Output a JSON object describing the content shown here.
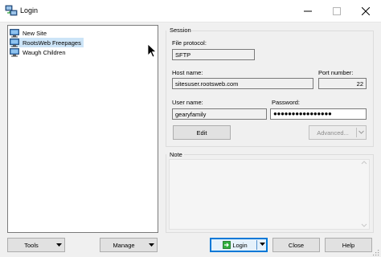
{
  "window": {
    "title": "Login",
    "controls": {
      "minimize": "minimize-icon",
      "maximize": "maximize-icon",
      "close": "close-icon"
    }
  },
  "sites": {
    "items": [
      {
        "label": "New Site",
        "icon": "computer-icon",
        "selected": false
      },
      {
        "label": "RootsWeb Freepages",
        "icon": "computer-icon",
        "selected": true
      },
      {
        "label": "Waugh Children",
        "icon": "computer-icon",
        "selected": false
      }
    ]
  },
  "session": {
    "group_label": "Session",
    "file_protocol": {
      "label": "File protocol:",
      "value": "SFTP"
    },
    "host_name": {
      "label": "Host name:",
      "value": "sitesuser.rootsweb.com"
    },
    "port_number": {
      "label": "Port number:",
      "value": "22"
    },
    "user_name": {
      "label": "User name:",
      "value": "gearyfamily"
    },
    "password": {
      "label": "Password:",
      "value": "●●●●●●●●●●●●●●●●"
    },
    "edit_label": "Edit",
    "advanced_label": "Advanced..."
  },
  "note": {
    "group_label": "Note",
    "text": ""
  },
  "buttons": {
    "tools": "Tools",
    "manage": "Manage",
    "login": "Login",
    "close": "Close",
    "help": "Help"
  },
  "colors": {
    "selection": "#cce4f7",
    "default_button_border": "#0078d7",
    "window_bg": "#f0f0f0"
  }
}
